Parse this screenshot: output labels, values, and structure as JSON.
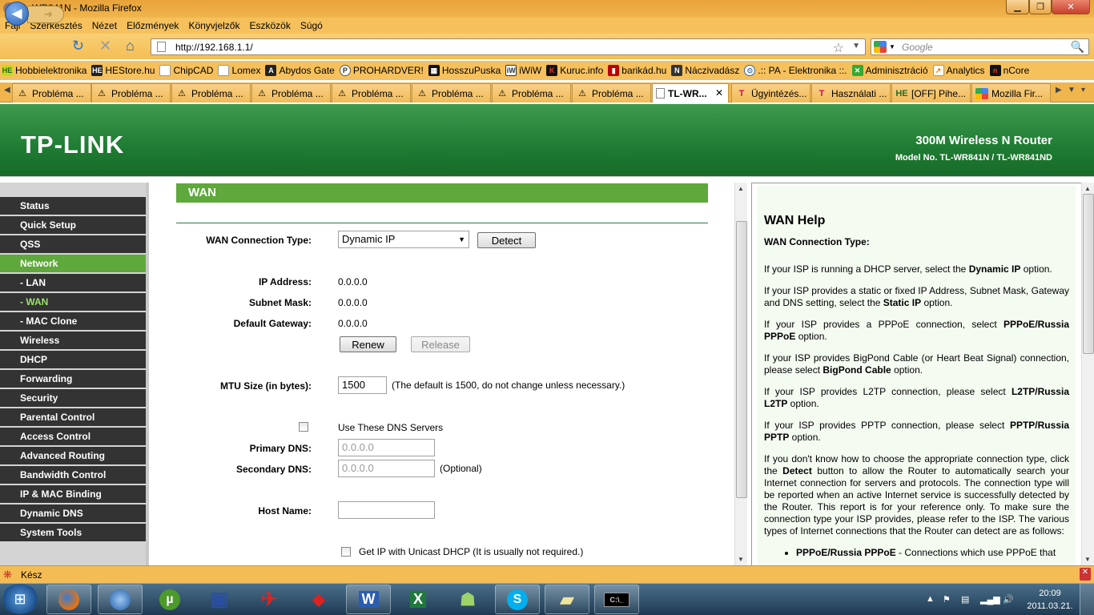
{
  "window": {
    "title": "TL-WR841N - Mozilla Firefox"
  },
  "menu": [
    "Fájl",
    "Szerkesztés",
    "Nézet",
    "Előzmények",
    "Könyvjelzők",
    "Eszközök",
    "Súgó"
  ],
  "urlbar": {
    "url": "http://192.168.1.1/"
  },
  "searchbar": {
    "placeholder": "Google"
  },
  "bookmarks": [
    {
      "label": "Hobbielektronika",
      "icon": "HE"
    },
    {
      "label": "HEStore.hu",
      "icon": "HE"
    },
    {
      "label": "ChipCAD",
      "icon": "doc"
    },
    {
      "label": "Lomex",
      "icon": "doc"
    },
    {
      "label": "Abydos Gate",
      "icon": "A"
    },
    {
      "label": "PROHARDVER!",
      "icon": "P"
    },
    {
      "label": "HosszuPuska",
      "icon": "H"
    },
    {
      "label": "iWiW",
      "icon": "iW"
    },
    {
      "label": "Kuruc.info",
      "icon": "K"
    },
    {
      "label": "barikád.hu",
      "icon": "B"
    },
    {
      "label": "Náczivadász",
      "icon": "N"
    },
    {
      "label": ".:: PA - Elektronika ::.",
      "icon": "PA"
    },
    {
      "label": "Adminisztráció",
      "icon": "X"
    },
    {
      "label": "Analytics",
      "icon": "An"
    },
    {
      "label": "nCore",
      "icon": "n"
    }
  ],
  "tabs": [
    {
      "label": "Probléma ...",
      "icon": "warning"
    },
    {
      "label": "Probléma ...",
      "icon": "warning"
    },
    {
      "label": "Probléma ...",
      "icon": "warning"
    },
    {
      "label": "Probléma ...",
      "icon": "warning"
    },
    {
      "label": "Probléma ...",
      "icon": "warning"
    },
    {
      "label": "Probléma ...",
      "icon": "warning"
    },
    {
      "label": "Probléma ...",
      "icon": "warning"
    },
    {
      "label": "Probléma ...",
      "icon": "warning"
    },
    {
      "label": "TL-WR...",
      "icon": "page",
      "active": true
    },
    {
      "label": "Ügyintézés...",
      "icon": "telekom"
    },
    {
      "label": "Használati ...",
      "icon": "telekom"
    },
    {
      "label": "[OFF] Pihe...",
      "icon": "HE"
    },
    {
      "label": "Mozilla Fir...",
      "icon": "google"
    }
  ],
  "router": {
    "logo": "TP-LINK",
    "product": "300M Wireless N Router",
    "model": "Model No. TL-WR841N / TL-WR841ND"
  },
  "sidebar": [
    {
      "label": "Status"
    },
    {
      "label": "Quick Setup"
    },
    {
      "label": "QSS"
    },
    {
      "label": "Network",
      "active": true
    },
    {
      "label": "- LAN",
      "sub": true
    },
    {
      "label": "- WAN",
      "sub": true,
      "active": true
    },
    {
      "label": "- MAC Clone",
      "sub": true
    },
    {
      "label": "Wireless"
    },
    {
      "label": "DHCP"
    },
    {
      "label": "Forwarding"
    },
    {
      "label": "Security"
    },
    {
      "label": "Parental Control"
    },
    {
      "label": "Access Control"
    },
    {
      "label": "Advanced Routing"
    },
    {
      "label": "Bandwidth Control"
    },
    {
      "label": "IP & MAC Binding"
    },
    {
      "label": "Dynamic DNS"
    },
    {
      "label": "System Tools"
    }
  ],
  "wan": {
    "heading": "WAN",
    "conn_type_label": "WAN Connection Type:",
    "conn_type_value": "Dynamic IP",
    "detect": "Detect",
    "ip_label": "IP Address:",
    "ip_value": "0.0.0.0",
    "mask_label": "Subnet Mask:",
    "mask_value": "0.0.0.0",
    "gw_label": "Default Gateway:",
    "gw_value": "0.0.0.0",
    "renew": "Renew",
    "release": "Release",
    "mtu_label": "MTU Size (in bytes):",
    "mtu_value": "1500",
    "mtu_note": "(The default is 1500, do not change unless necessary.)",
    "dns_check_label": "Use These DNS Servers",
    "primary_dns_label": "Primary DNS:",
    "primary_dns_value": "0.0.0.0",
    "secondary_dns_label": "Secondary DNS:",
    "secondary_dns_value": "0.0.0.0",
    "optional": "(Optional)",
    "host_label": "Host Name:",
    "host_value": "",
    "unicast_label": "Get IP with Unicast DHCP (It is usually not required.)"
  },
  "help": {
    "title": "WAN Help",
    "subtitle": "WAN Connection Type:",
    "p1a": "If your ISP is running a DHCP server, select the ",
    "p1b": "Dynamic IP",
    "p1c": " option.",
    "p2a": "If your ISP provides a static or fixed IP Address, Subnet Mask, Gateway and DNS setting, select the ",
    "p2b": "Static IP",
    "p2c": " option.",
    "p3a": "If your ISP provides a PPPoE connection, select ",
    "p3b": "PPPoE/Russia PPPoE",
    "p3c": " option.",
    "p4a": "If your ISP provides BigPond Cable (or Heart Beat Signal) connection, please select ",
    "p4b": "BigPond Cable",
    "p4c": " option.",
    "p5a": "If your ISP provides L2TP connection, please select ",
    "p5b": "L2TP/Russia L2TP",
    "p5c": " option.",
    "p6a": "If your ISP provides PPTP connection, please select ",
    "p6b": "PPTP/Russia PPTP",
    "p6c": " option.",
    "p7a": "If you don't know how to choose the appropriate connection type, click the ",
    "p7b": "Detect",
    "p7c": " button to allow the Router to automatically search your Internet connection for servers and protocols. The connection type will be reported when an active Internet service is successfully detected by the Router. This report is for your reference only. To make sure the connection type your ISP provides, please refer to the ISP. The various types of Internet connections that the Router can detect are as follows:",
    "li1a": "PPPoE/Russia PPPoE",
    "li1b": " - Connections which use PPPoE that"
  },
  "status": {
    "text": "Kész"
  },
  "clock": {
    "time": "20:09",
    "date": "2011.03.21."
  }
}
